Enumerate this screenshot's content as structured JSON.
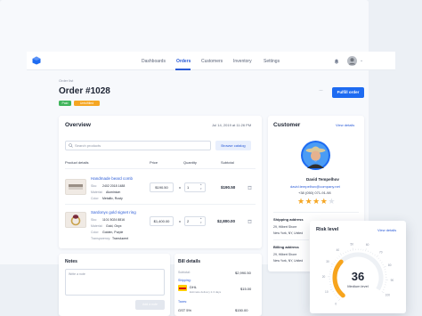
{
  "nav": {
    "items": [
      "Dashboards",
      "Orders",
      "Customers",
      "Inventory",
      "Settings"
    ]
  },
  "header": {
    "breadcrumb": "Order list",
    "title": "Order #1028",
    "badges": [
      "Paid",
      "Unfulfilled"
    ],
    "more_label": "···",
    "fulfill_label": "Fulfill order"
  },
  "overview": {
    "title": "Overview",
    "date": "Jul 14, 2019 at 11:26 PM",
    "search_placeholder": "Search products",
    "browse_label": "Browse catalog",
    "columns": [
      "Product details",
      "Price",
      "Quantity",
      "Subtotal"
    ],
    "products": [
      {
        "name": "Handmade beard comb",
        "sku_label": "Sku:",
        "sku": "2402 2018 1488",
        "material_label": "Material:",
        "material": "Aluminium",
        "color_label": "Color:",
        "color": "Metallic, Rusty",
        "price": "$190.50",
        "times": "x",
        "qty": "1",
        "subtotal": "$190.50"
      },
      {
        "name": "Sardonyx gold signet ring",
        "sku_label": "Sku:",
        "sku": "1101 5024 8816",
        "material_label": "Material:",
        "material": "Gold, Onyx",
        "color_label": "Color:",
        "color": "Golden, Purple",
        "transparency_label": "Transparency:",
        "transparency": "Translucent",
        "price": "$1,400.00",
        "times": "x",
        "qty": "2",
        "subtotal": "$2,800.00"
      }
    ]
  },
  "notes": {
    "title": "Notes",
    "placeholder": "Write a note",
    "button_label": "Add a note"
  },
  "bill": {
    "title": "Bill details",
    "subtotal_label": "Subtotal:",
    "subtotal": "$2,990.50",
    "shipping_label": "Shipping:",
    "carrier": "DHL",
    "carrier_detail": "Estimate delivery 2-3 days",
    "shipping": "$15.00",
    "taxes_label": "Taxes:",
    "gst_label": "GST 5%",
    "gst": "$150.00"
  },
  "customer": {
    "title": "Customer",
    "view_label": "View details",
    "name": "David Tempelhov",
    "email": "david.tempelhov@company.net",
    "phone": "+38 (050) 071-91-98",
    "rating": 4,
    "rating_max": 5,
    "shipping_title": "Shipping address",
    "shipping_lines": [
      "29, Hilbert Shore",
      "New York, NY, United"
    ],
    "billing_title": "Billing address",
    "billing_lines": [
      "29, Hilbert Shore",
      "New York, NY, United"
    ]
  },
  "risk": {
    "title": "Risk level",
    "view_label": "View details",
    "value": 36,
    "label": "Medium level",
    "ticks": [
      "0",
      "10",
      "20",
      "30",
      "40",
      "50",
      "60",
      "70",
      "80",
      "90",
      "100"
    ]
  },
  "colors": {
    "primary": "#1e6bf1",
    "paid": "#3fb45b",
    "unfulfilled": "#f5a623",
    "gauge": "#f7a41c",
    "star": "#f5a623"
  }
}
